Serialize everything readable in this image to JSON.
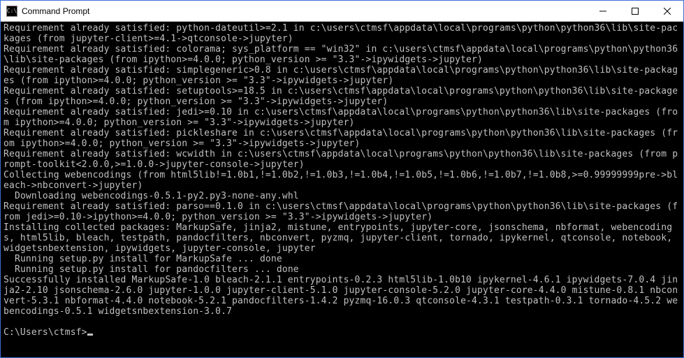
{
  "window": {
    "title": "Command Prompt",
    "icon_label": "C:\\"
  },
  "terminal": {
    "output": "Requirement already satisfied: python-dateutil>=2.1 in c:\\users\\ctmsf\\appdata\\local\\programs\\python\\python36\\lib\\site-packages (from jupyter-client>=4.1->qtconsole->jupyter)\nRequirement already satisfied: colorama; sys_platform == \"win32\" in c:\\users\\ctmsf\\appdata\\local\\programs\\python\\python36\\lib\\site-packages (from ipython>=4.0.0; python_version >= \"3.3\"->ipywidgets->jupyter)\nRequirement already satisfied: simplegeneric>0.8 in c:\\users\\ctmsf\\appdata\\local\\programs\\python\\python36\\lib\\site-packages (from ipython>=4.0.0; python_version >= \"3.3\"->ipywidgets->jupyter)\nRequirement already satisfied: setuptools>=18.5 in c:\\users\\ctmsf\\appdata\\local\\programs\\python\\python36\\lib\\site-packages (from ipython>=4.0.0; python_version >= \"3.3\"->ipywidgets->jupyter)\nRequirement already satisfied: jedi>=0.10 in c:\\users\\ctmsf\\appdata\\local\\programs\\python\\python36\\lib\\site-packages (from ipython>=4.0.0; python_version >= \"3.3\"->ipywidgets->jupyter)\nRequirement already satisfied: pickleshare in c:\\users\\ctmsf\\appdata\\local\\programs\\python\\python36\\lib\\site-packages (from ipython>=4.0.0; python_version >= \"3.3\"->ipywidgets->jupyter)\nRequirement already satisfied: wcwidth in c:\\users\\ctmsf\\appdata\\local\\programs\\python\\python36\\lib\\site-packages (from prompt-toolkit<2.0.0,>=1.0.0->jupyter-console->jupyter)\nCollecting webencodings (from html5lib!=1.0b1,!=1.0b2,!=1.0b3,!=1.0b4,!=1.0b5,!=1.0b6,!=1.0b7,!=1.0b8,>=0.99999999pre->bleach->nbconvert->jupyter)\n  Downloading webencodings-0.5.1-py2.py3-none-any.whl\nRequirement already satisfied: parso==0.1.0 in c:\\users\\ctmsf\\appdata\\local\\programs\\python\\python36\\lib\\site-packages (from jedi>=0.10->ipython>=4.0.0; python_version >= \"3.3\"->ipywidgets->jupyter)\nInstalling collected packages: MarkupSafe, jinja2, mistune, entrypoints, jupyter-core, jsonschema, nbformat, webencodings, html5lib, bleach, testpath, pandocfilters, nbconvert, pyzmq, jupyter-client, tornado, ipykernel, qtconsole, notebook, widgetsnbextension, ipywidgets, jupyter-console, jupyter\n  Running setup.py install for MarkupSafe ... done\n  Running setup.py install for pandocfilters ... done\nSuccessfully installed MarkupSafe-1.0 bleach-2.1.1 entrypoints-0.2.3 html5lib-1.0b10 ipykernel-4.6.1 ipywidgets-7.0.4 jinja2-2.10 jsonschema-2.6.0 jupyter-1.0.0 jupyter-client-5.1.0 jupyter-console-5.2.0 jupyter-core-4.4.0 mistune-0.8.1 nbconvert-5.3.1 nbformat-4.4.0 notebook-5.2.1 pandocfilters-1.4.2 pyzmq-16.0.3 qtconsole-4.3.1 testpath-0.3.1 tornado-4.5.2 webencodings-0.5.1 widgetsnbextension-3.0.7\n",
    "prompt": "C:\\Users\\ctmsf>"
  }
}
